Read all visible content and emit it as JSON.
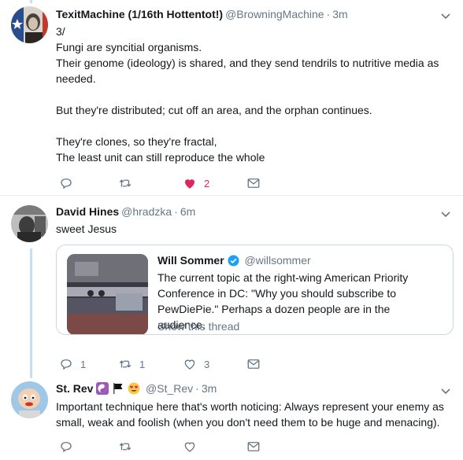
{
  "tweets": [
    {
      "name": "TexitMachine (1/16th Hottentot!)",
      "handle": "@BrowningMachine",
      "dot": "·",
      "time": "3m",
      "lines": [
        "3/",
        "Fungi are syncitial organisms.",
        "Their genome (ideology) is shared, and they send tendrils to nutritive media as needed.",
        "",
        "But they're distributed; cut off an area, and the orphan continues.",
        "",
        "They're clones, so they're fractal,",
        "The least unit can still reproduce the whole"
      ],
      "actions": {
        "reply": "",
        "retweet": "",
        "like": "2"
      }
    },
    {
      "name": "David Hines",
      "handle": "@hradzka",
      "dot": "·",
      "time": "6m",
      "text": "sweet Jesus",
      "quote": {
        "name": "Will Sommer",
        "handle": "@willsommer",
        "text": "The current topic at the right-wing American Priority Conference in DC: \"Why you should subscribe to PewDiePie.\" Perhaps a dozen people are in the audience.",
        "link": "Show this thread"
      },
      "actions": {
        "reply": "1",
        "retweet": "1",
        "like": "3"
      }
    },
    {
      "name": "St. Rev",
      "handle": "@St_Rev",
      "dot": "·",
      "time": "3m",
      "text": "Important technique here that's worth noticing: Always represent your enemy as small, weak and foolish (when you don't need them to be huge and menacing).",
      "actions": {
        "reply": "",
        "retweet": "",
        "like": ""
      }
    }
  ],
  "colors": {
    "accent": "#1da1f2",
    "like": "#e0245e",
    "muted": "#657786",
    "thread": "#c4e0f5"
  },
  "icons": [
    "reply-icon",
    "retweet-icon",
    "heart-icon",
    "direct-message-icon",
    "chevron-down-icon",
    "verified-badge-icon"
  ]
}
